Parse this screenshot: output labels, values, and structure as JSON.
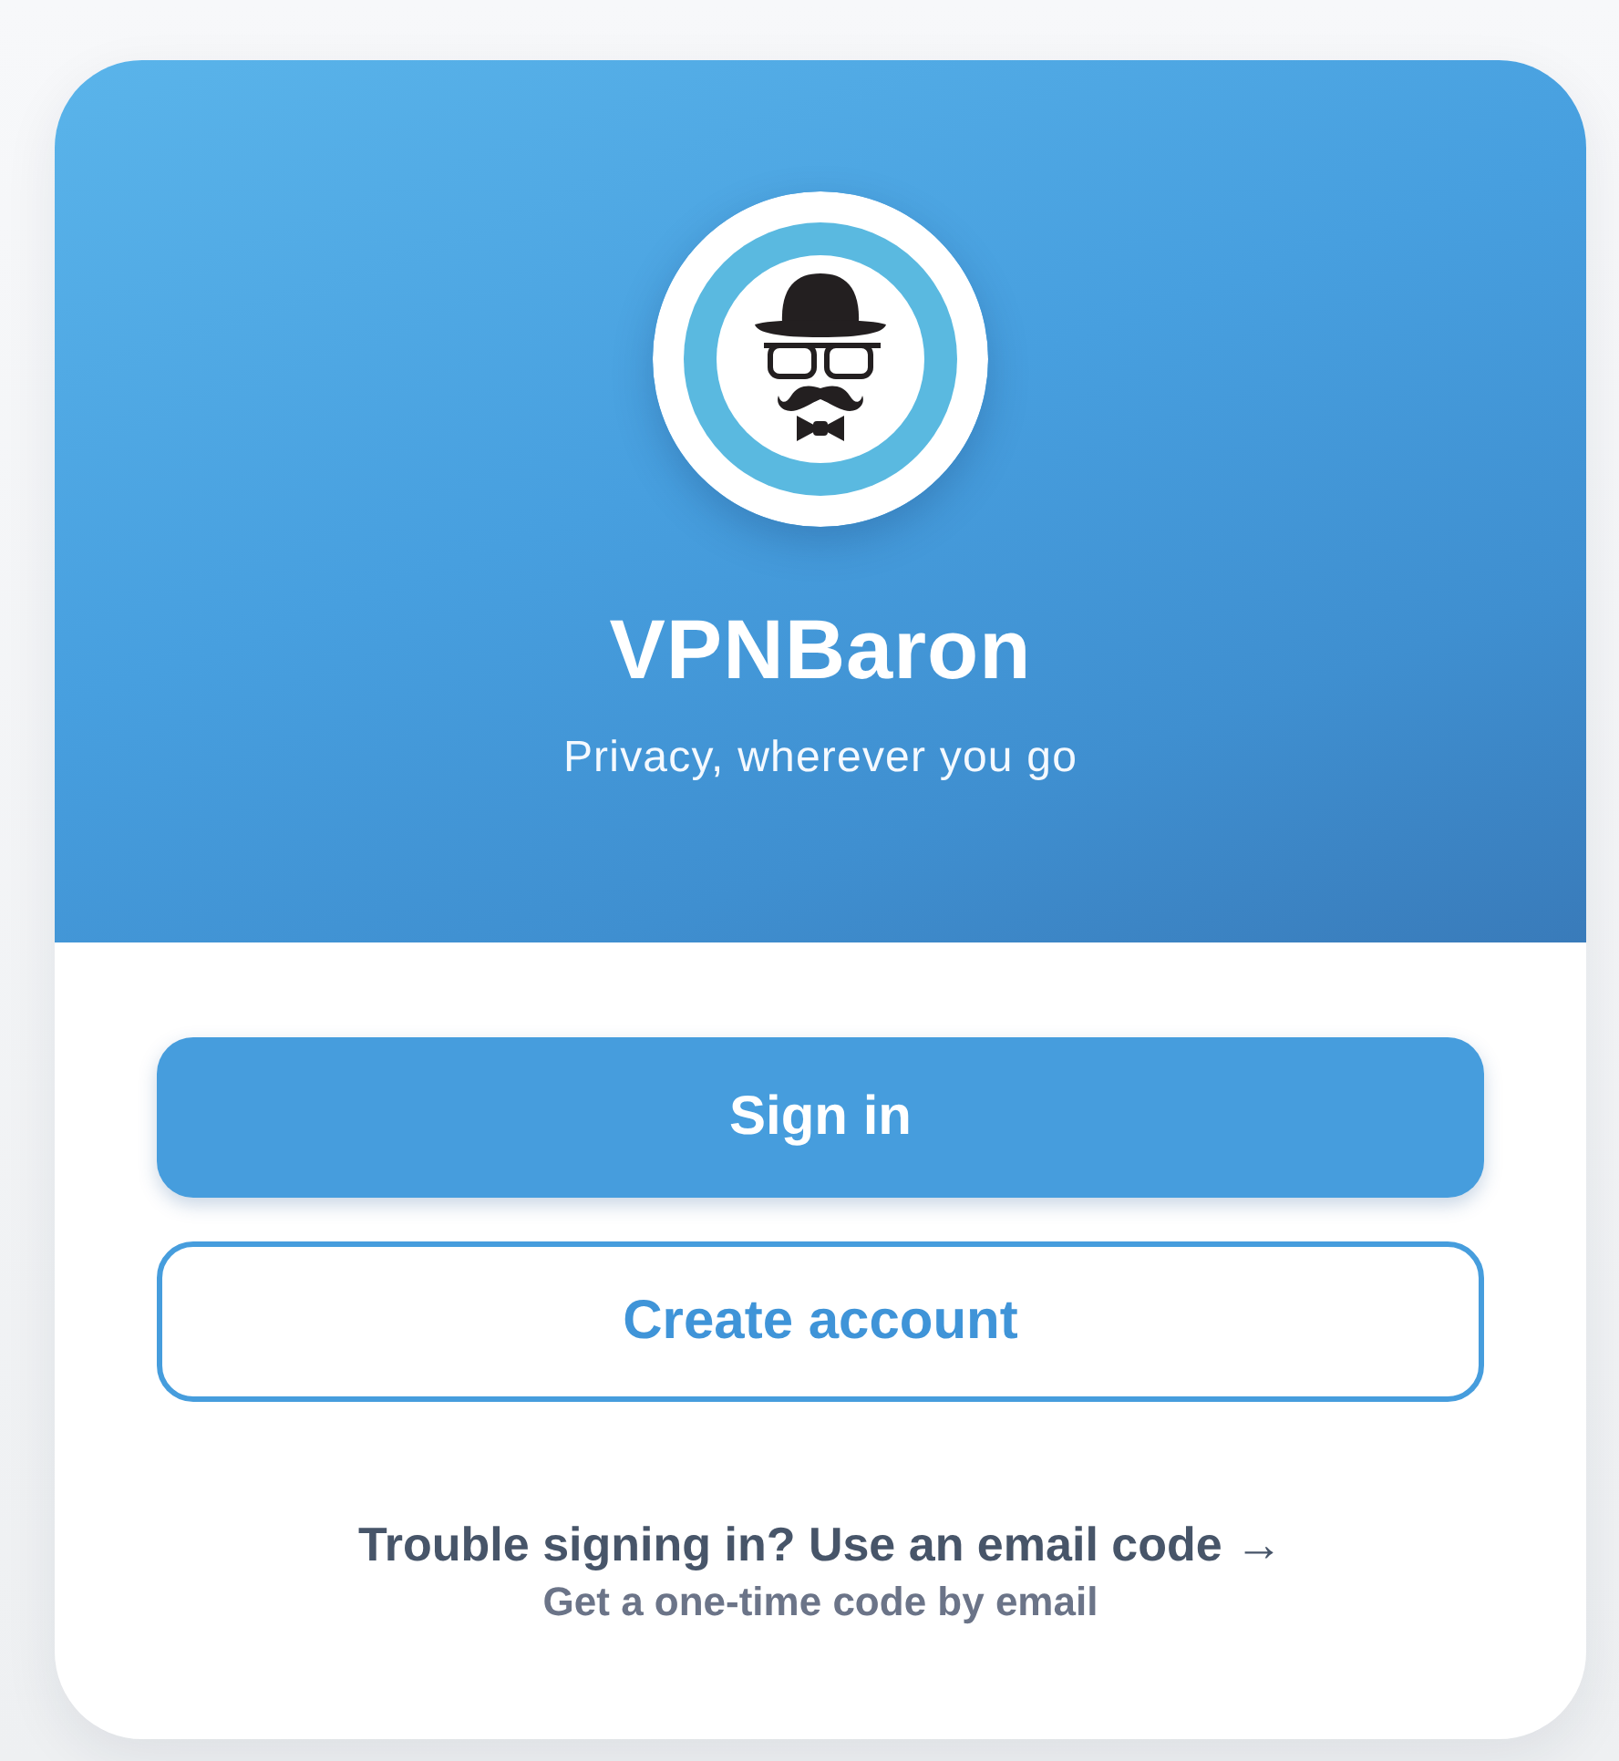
{
  "header": {
    "app_name": "VPNBaron",
    "tagline": "Privacy, wherever you go"
  },
  "actions": [
    {
      "label": "Sign in",
      "kind": "primary"
    },
    {
      "label": "Create account",
      "kind": "secondary"
    }
  ],
  "help": {
    "link": "Trouble signing in? Use an email code →",
    "hint": "Get a one-time code by email"
  }
}
